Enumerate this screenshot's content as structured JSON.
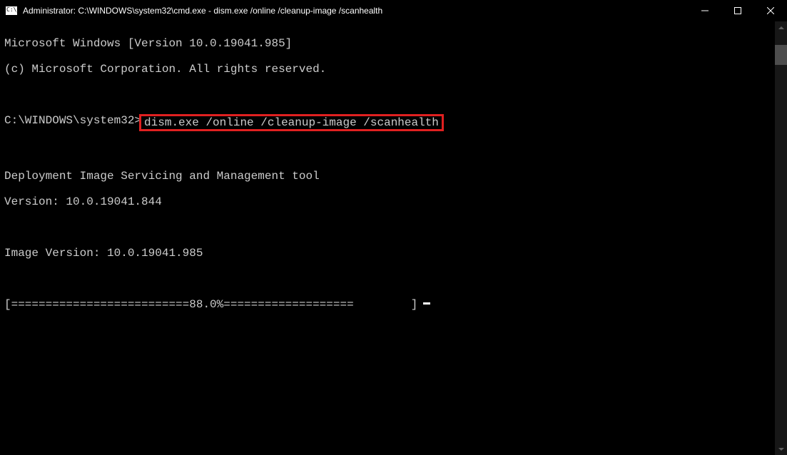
{
  "titlebar": {
    "text": "Administrator: C:\\WINDOWS\\system32\\cmd.exe - dism.exe  /online /cleanup-image /scanhealth"
  },
  "terminal": {
    "line1": "Microsoft Windows [Version 10.0.19041.985]",
    "line2": "(c) Microsoft Corporation. All rights reserved.",
    "blank": "",
    "prompt_prefix": "C:\\WINDOWS\\system32>",
    "command": "dism.exe /online /cleanup-image /scanhealth",
    "tool_line1": "Deployment Image Servicing and Management tool",
    "tool_line2": "Version: 10.0.19041.844",
    "image_version": "Image Version: 10.0.19041.985",
    "progress_left": "[==========================88.0%===================",
    "progress_right": "]"
  }
}
